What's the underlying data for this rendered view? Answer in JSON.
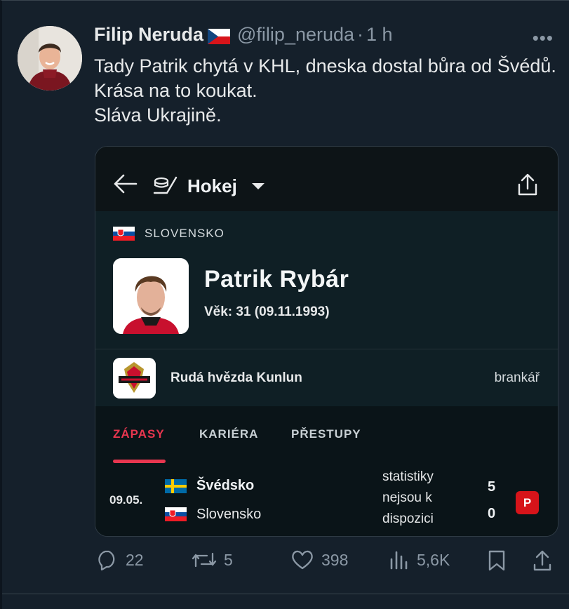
{
  "author": {
    "name": "Filip Neruda",
    "handle": "@filip_neruda",
    "separator": "·",
    "time": "1 h",
    "flag_icon": "czech-flag-icon"
  },
  "more_label": "•••",
  "tweet_text": "Tady Patrik chytá v KHL, dneska dostal bůra od Švédů. Krása na to koukat.\nSláva Ukrajině.",
  "card": {
    "sport_label": "Hokej",
    "country": "SLOVENSKO",
    "player_name": "Patrik Rybár",
    "age_line": "Věk: 31 (09.11.1993)",
    "team_name": "Rudá hvězda Kunlun",
    "position": "brankář",
    "tabs": [
      {
        "label": "ZÁPASY",
        "active": true
      },
      {
        "label": "KARIÉRA",
        "active": false
      },
      {
        "label": "PŘESTUPY",
        "active": false
      }
    ],
    "match": {
      "date": "09.05.",
      "home_team": "Švédsko",
      "away_team": "Slovensko",
      "stats_text": "statistiky\nnejsou k\ndispozici",
      "home_score": "5",
      "away_score": "0",
      "result_badge": "P"
    }
  },
  "actions": {
    "replies": "22",
    "reposts": "5",
    "likes": "398",
    "views": "5,6K"
  },
  "colors": {
    "accent_red": "#e8364f",
    "badge_red": "#d7141a",
    "background": "#15202b"
  }
}
